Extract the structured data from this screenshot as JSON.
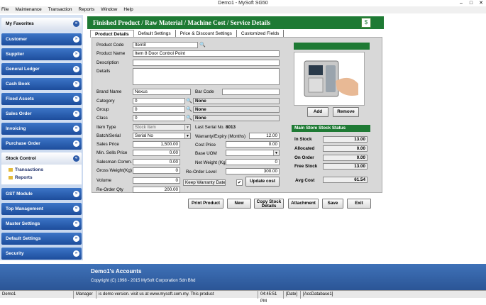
{
  "window": {
    "title": "Demo1 - MySoft SG50",
    "min": "–",
    "max": "□",
    "close": "✕"
  },
  "menu": [
    "File",
    "Maintenance",
    "Transaction",
    "Reports",
    "Window",
    "Help"
  ],
  "sidebar": {
    "favorites": "My Favorites",
    "items": [
      "Customer",
      "Supplier",
      "General Ledger",
      "Cash Book",
      "Fixed Assets",
      "Sales Order",
      "Invoicing",
      "Purchase Order"
    ],
    "stock_control": "Stock Control",
    "stock_sub": [
      "Transactions",
      "Reports"
    ],
    "items2": [
      "GST Module",
      "Top Management",
      "Master Settings",
      "Default Settings",
      "Security"
    ]
  },
  "header": {
    "title": "Finished Product / Raw Material / Machine Cost / Service Details",
    "icon": "$"
  },
  "tabs": [
    "Product Details",
    "Default Settings",
    "Price & Discount Settings",
    "Customized Fields"
  ],
  "form": {
    "product_code_label": "Product Code",
    "product_code": "Item8",
    "product_name_label": "Product Name",
    "product_name": "Item 8 Door Control Point",
    "description_label": "Description",
    "description": "",
    "details_label": "Details",
    "details": "",
    "brand_name_label": "Brand Name",
    "brand_name": "Nexus",
    "bar_code_label": "Bar Code",
    "bar_code": "",
    "category_label": "Category",
    "category": "0",
    "category_desc": "None",
    "group_label": "Group",
    "group": "0",
    "group_desc": "None",
    "class_label": "Class",
    "class": "0",
    "class_desc": "None",
    "item_type_label": "Item Type",
    "item_type": "Stock Item",
    "last_serial_label": "Last Serial No.",
    "last_serial": "8013",
    "batch_serial_label": "Batch/Serial",
    "batch_serial": "Serial No",
    "warranty_label": "Warranty/Expiry (Months)",
    "warranty": "12.00",
    "sales_price_label": "Sales Price",
    "sales_price": "1,500.00",
    "cost_price_label": "Cost Price",
    "cost_price": "0.00",
    "min_sells_label": "Min. Sells Price",
    "min_sells": "0.00",
    "base_uom_label": "Base UOM",
    "base_uom": "",
    "salesman_label": "Salesman Comm.",
    "salesman": "0.00",
    "net_weight_label": "Net Weight (Kg)",
    "net_weight": "0",
    "gross_weight_label": "Gross Weight(Kg)",
    "gross_weight": "0",
    "reorder_level_label": "Re-Order Level",
    "reorder_level": "300.00",
    "volume_label": "Volume",
    "volume": "0",
    "keep_warranty_label": "Keep Warranty Date",
    "keep_warranty_check": "✔",
    "update_cost": "Update cost",
    "reorder_qty_label": "Re-Order Qty",
    "reorder_qty": "200.00"
  },
  "image_panel": {
    "add": "Add",
    "remove": "Remove"
  },
  "stock_status": {
    "title": "Main Store Stock Status",
    "rows": [
      {
        "label": "In Stock",
        "value": "13.00"
      },
      {
        "label": "Allocated",
        "value": "0.00"
      },
      {
        "label": "On Order",
        "value": "0.00"
      },
      {
        "label": "Free Stock",
        "value": "13.00"
      }
    ],
    "avg_cost_label": "Avg Cost",
    "avg_cost": "61.54"
  },
  "actions": {
    "print": "Print Product",
    "new": "New",
    "copy_line1": "Copy Stock",
    "copy_line2": "Details",
    "attachment": "Attachment",
    "save": "Save",
    "exit": "Exit"
  },
  "footer": {
    "company": "Demo1's Accounts",
    "copyright": "Copyright (C) 1998 - 2015 MySoft Corporation Sdn Bhd"
  },
  "statusbar": {
    "db": "Demo1",
    "role": "Manager",
    "message": "is demo version. visit us at www.mysoft.com.my. This product",
    "time": "04:45:51 PM",
    "date": "[Date]",
    "database": "[AccDatabase1]"
  }
}
